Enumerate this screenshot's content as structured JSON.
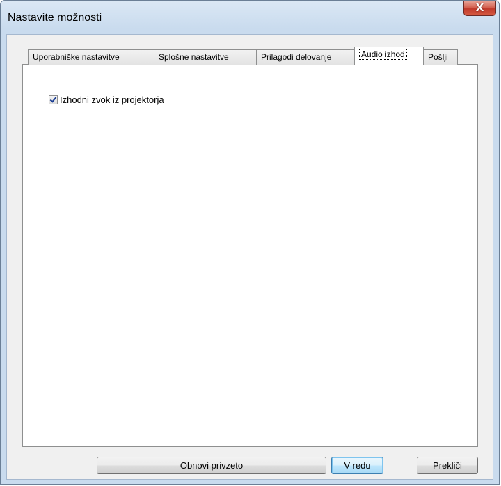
{
  "window": {
    "title": "Nastavite možnosti",
    "close_label": "X"
  },
  "tabs": [
    {
      "label": "Uporabniške nastavitve",
      "active": false
    },
    {
      "label": "Splošne nastavitve",
      "active": false
    },
    {
      "label": "Prilagodi delovanje",
      "active": false
    },
    {
      "label": "Audio izhod",
      "active": true
    },
    {
      "label": "Pošlji",
      "active": false
    }
  ],
  "panel": {
    "checkbox_label": "Izhodni zvok iz projektorja",
    "checkbox_checked": true
  },
  "buttons": {
    "restore": "Obnovi privzeto",
    "ok": "V redu",
    "cancel": "Prekliči"
  },
  "colors": {
    "frame": "#c9dbee",
    "close_button": "#c0392b",
    "default_button_border": "#3c7fb1",
    "checkmark": "#1c3f94"
  }
}
